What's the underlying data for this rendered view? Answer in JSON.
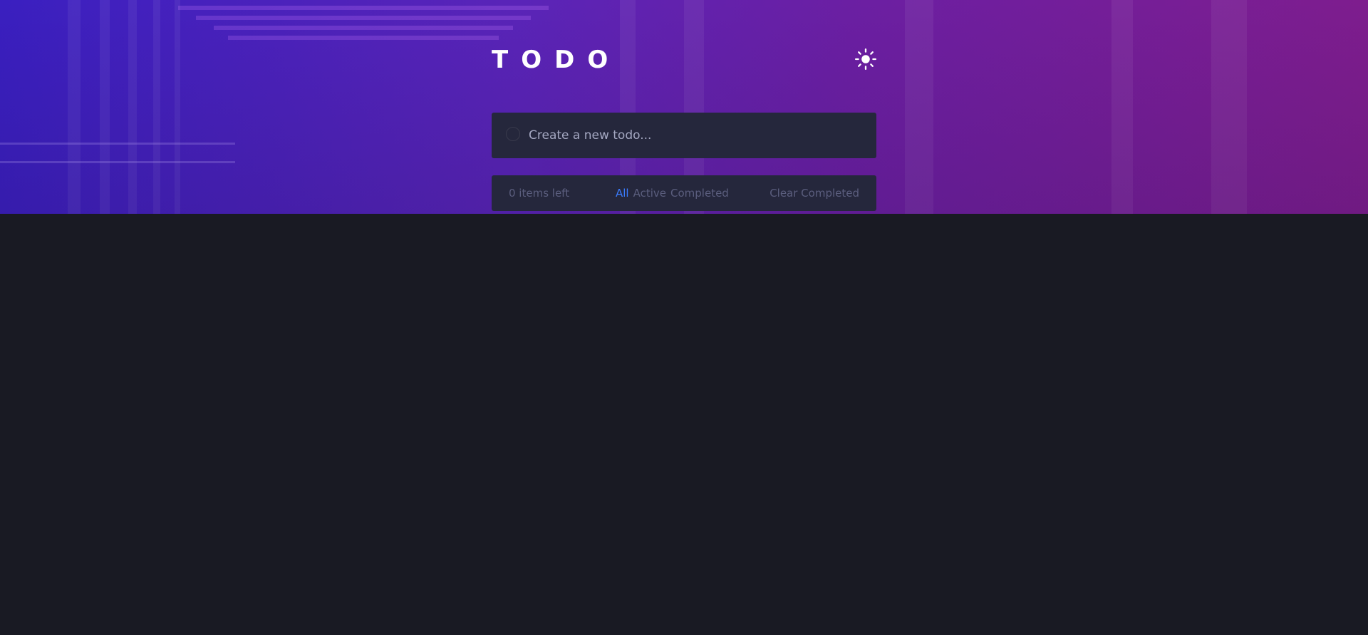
{
  "header": {
    "title": "TODO",
    "theme_toggle_icon": "sun-icon"
  },
  "new_todo": {
    "placeholder": "Create a new todo...",
    "value": ""
  },
  "footer": {
    "items_left": "0 items left",
    "filters": [
      {
        "label": "All",
        "active": true
      },
      {
        "label": "Active",
        "active": false
      },
      {
        "label": "Completed",
        "active": false
      }
    ],
    "clear_label": "Clear Completed"
  },
  "colors": {
    "background": "#191a23",
    "panel": "#25273c",
    "accent": "#3a7bfd",
    "muted_text": "#5b5e7e",
    "placeholder_text": "#a5a8c2"
  }
}
